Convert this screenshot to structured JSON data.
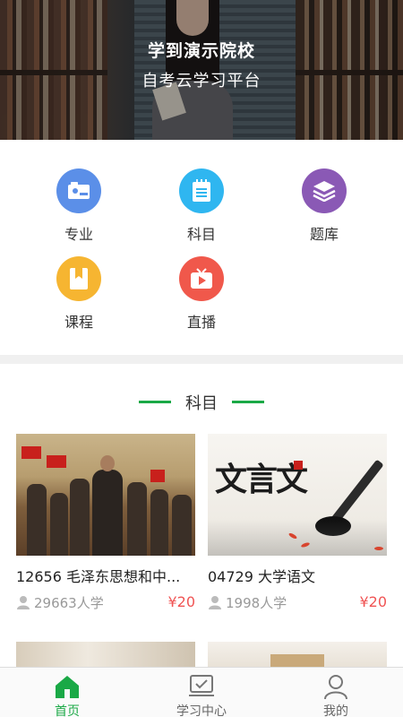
{
  "banner": {
    "title": "学到演示院校",
    "subtitle": "自考云学习平台"
  },
  "menu": {
    "items": [
      {
        "label": "专业",
        "icon": "major-icon",
        "color": "#5b8fe8"
      },
      {
        "label": "科目",
        "icon": "notebook-icon",
        "color": "#2fb6f0"
      },
      {
        "label": "题库",
        "icon": "layers-icon",
        "color": "#8a59b5"
      },
      {
        "label": "课程",
        "icon": "bookmark-book-icon",
        "color": "#f6b531"
      },
      {
        "label": "直播",
        "icon": "tv-play-icon",
        "color": "#f0584b"
      }
    ]
  },
  "section": {
    "title": "科目",
    "accent": "#1aa946",
    "courses": [
      {
        "name": "12656 毛泽东思想和中...",
        "learners": "29663人学",
        "price": "¥20"
      },
      {
        "name": "04729 大学语文",
        "learners": "1998人学",
        "price": "¥20",
        "thumb_text": "文言文"
      }
    ]
  },
  "tabbar": {
    "active_color": "#1aa946",
    "tabs": [
      {
        "label": "首页",
        "icon": "home-icon",
        "active": true
      },
      {
        "label": "学习中心",
        "icon": "study-center-icon",
        "active": false
      },
      {
        "label": "我的",
        "icon": "profile-icon",
        "active": false
      }
    ]
  }
}
